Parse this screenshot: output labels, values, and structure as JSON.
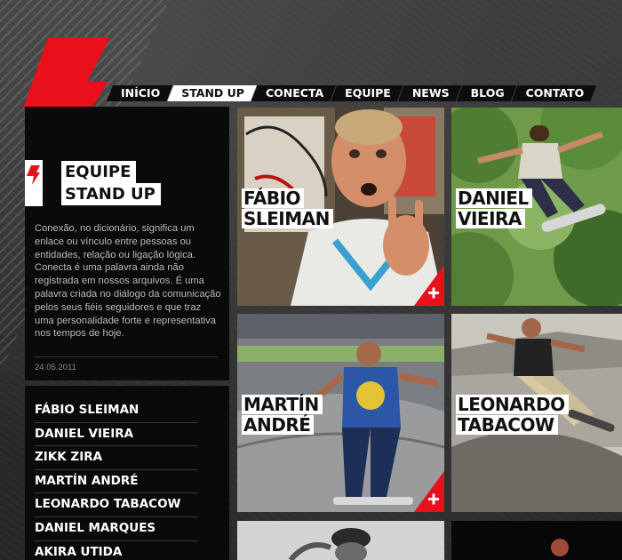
{
  "nav": {
    "items": [
      {
        "label": "INÍCIO",
        "active": false
      },
      {
        "label": "STAND UP",
        "active": true
      },
      {
        "label": "CONECTA",
        "active": false
      },
      {
        "label": "EQUIPE",
        "active": false
      },
      {
        "label": "NEWS",
        "active": false
      },
      {
        "label": "BLOG",
        "active": false
      },
      {
        "label": "CONTATO",
        "active": false
      }
    ]
  },
  "team": {
    "title_line1": "EQUIPE",
    "title_line2": "STAND UP",
    "description": "Conexão, no dicionário, significa um enlace ou vínculo entre pessoas ou entidades, relação ou ligação lógica. Conecta é uma palavra ainda não registrada em nossos arquivos. É uma palavra criada no diálogo da comunicação pelos seus fiéis seguidores e que traz uma personalidade forte e representativa nos tempos de hoje.",
    "date": "24.05.2011"
  },
  "members": [
    "FÁBIO SLEIMAN",
    "DANIEL VIEIRA",
    "ZIKK ZIRA",
    "MARTÍN ANDRÉ",
    "LEONARDO TABACOW",
    "DANIEL MARQUES",
    "AKIRA UTIDA"
  ],
  "tiles": [
    {
      "first": "FÁBIO",
      "last": "SLEIMAN",
      "has_plus": true
    },
    {
      "first": "DANIEL",
      "last": "VIEIRA",
      "has_plus": false
    },
    {
      "first": "MARTÍN",
      "last": "ANDRÉ",
      "has_plus": true
    },
    {
      "first": "LEONARDO",
      "last": "TABACOW",
      "has_plus": false
    }
  ],
  "colors": {
    "accent": "#e8101b",
    "panel": "#0a0a0a",
    "text": "#ffffff",
    "muted": "#b9b9b9"
  },
  "icons": {
    "logo": "lightning-bolt-icon",
    "badge": "lightning-bolt-icon",
    "tile_more": "plus-icon"
  }
}
